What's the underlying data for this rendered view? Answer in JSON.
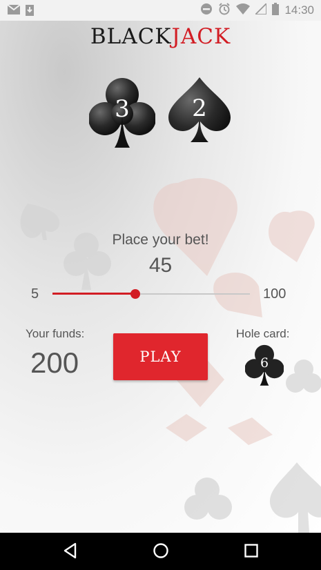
{
  "status_bar": {
    "time": "14:30",
    "left_icons": [
      "gmail-icon",
      "download-icon"
    ],
    "right_icons": [
      "do-not-disturb-icon",
      "alarm-icon",
      "wifi-icon",
      "signal-icon",
      "battery-icon"
    ]
  },
  "app": {
    "title_part1": "BLACK",
    "title_part2": "JACK",
    "accent_color": "#d21d24",
    "suits": [
      {
        "icon": "club-icon",
        "number": "3"
      },
      {
        "icon": "spade-icon",
        "number": "2"
      }
    ],
    "bet": {
      "prompt": "Place your bet!",
      "value": "45",
      "min_label": "5",
      "max_label": "100",
      "min": 5,
      "max": 100,
      "current": 45
    },
    "funds": {
      "label": "Your funds:",
      "value": "200"
    },
    "play_button": "PLAY",
    "hole_card": {
      "label": "Hole card:",
      "icon": "club-icon",
      "number": "6"
    }
  },
  "nav_bar": {
    "buttons": [
      "back-icon",
      "home-icon",
      "recents-icon"
    ]
  }
}
